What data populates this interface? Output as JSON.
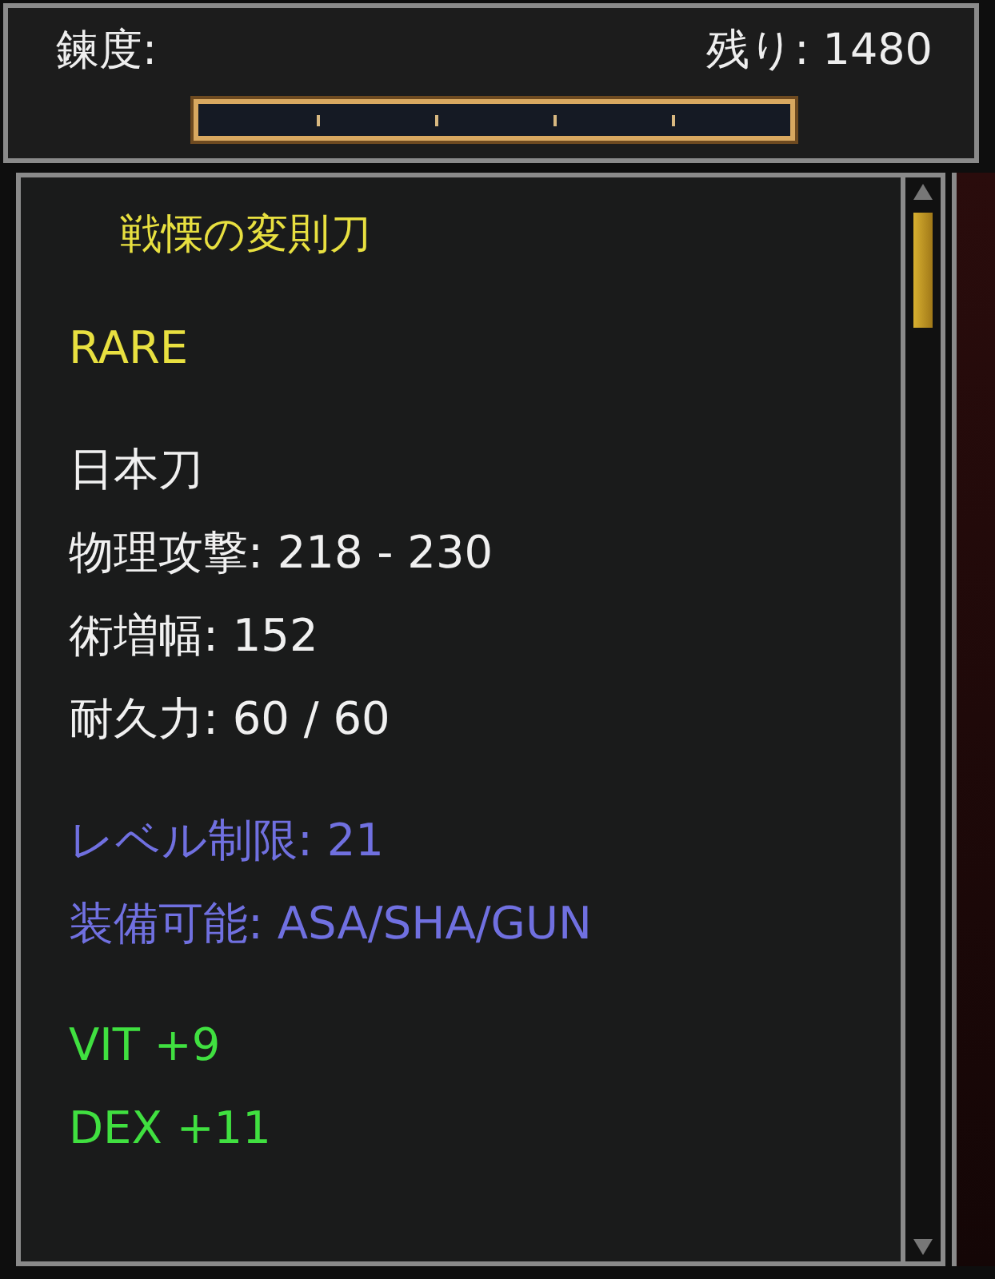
{
  "proficiency": {
    "label": "鍊度:",
    "remaining": "残り: 1480",
    "level": 0
  },
  "item": {
    "name": "戦慄の変則刀",
    "sections": [
      {
        "kind": "rarity",
        "lines": [
          "RARE"
        ]
      },
      {
        "kind": "stat",
        "lines": [
          "日本刀",
          "物理攻撃: 218 - 230",
          "術増幅: 152",
          "耐久力: 60 / 60"
        ]
      },
      {
        "kind": "requirement",
        "lines": [
          "レベル制限: 21",
          "装備可能:  ASA/SHA/GUN"
        ]
      },
      {
        "kind": "bonus",
        "lines": [
          "VIT +9",
          "DEX +11"
        ]
      }
    ]
  }
}
